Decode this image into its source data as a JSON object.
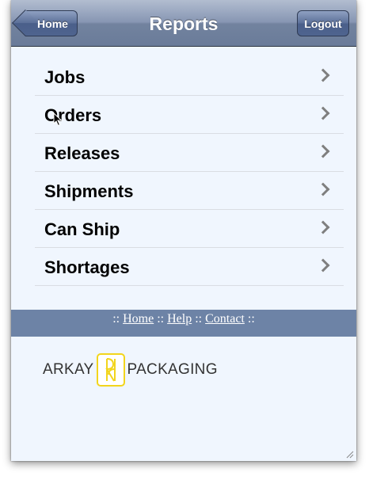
{
  "navbar": {
    "title": "Reports",
    "back_label": "Home",
    "logout_label": "Logout"
  },
  "reports": [
    {
      "label": "Jobs"
    },
    {
      "label": "Orders"
    },
    {
      "label": "Releases"
    },
    {
      "label": "Shipments"
    },
    {
      "label": "Can Ship"
    },
    {
      "label": "Shortages"
    }
  ],
  "footer": {
    "separator": "::",
    "links": [
      "Home",
      "Help",
      "Contact"
    ]
  },
  "logo": {
    "left_text": "ARKAY",
    "right_text": "PACKAGING",
    "mark_color": "#f2d51c"
  },
  "icons": {
    "row_arrow": "chevron-right-icon",
    "cursor": "mouse-pointer-icon"
  },
  "colors": {
    "navbar": "#6a7b99",
    "footer_bar": "#6d83a6",
    "background": "#f0f6fe"
  }
}
